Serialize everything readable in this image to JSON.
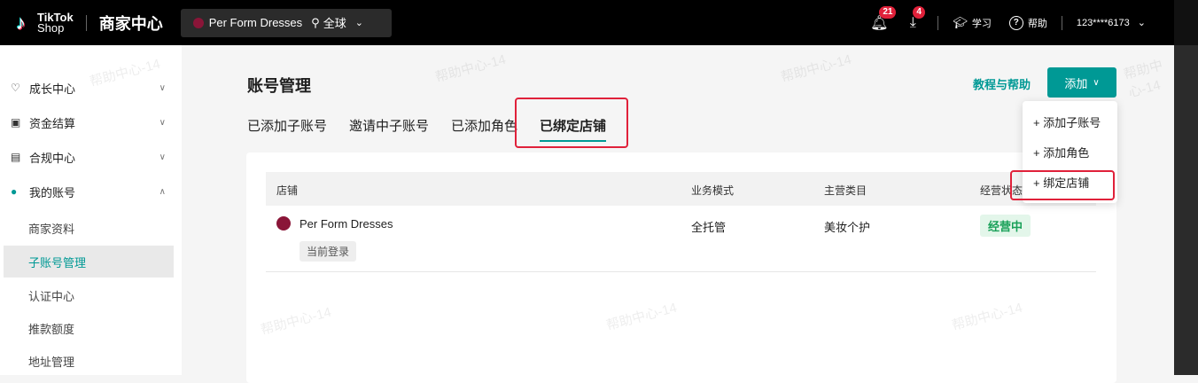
{
  "topbar": {
    "logo_line1": "TikTok",
    "logo_line2": "Shop",
    "center_title": "商家中心",
    "shop_name": "Per Form Dresses",
    "region": "全球",
    "notif_count": "21",
    "download_count": "4",
    "learn_label": "学习",
    "help_label": "帮助",
    "account": "123****6173"
  },
  "sidebar": {
    "items": [
      {
        "label": "成长中心"
      },
      {
        "label": "资金结算"
      },
      {
        "label": "合规中心"
      },
      {
        "label": "我的账号"
      }
    ],
    "sub_items": [
      {
        "label": "商家资料"
      },
      {
        "label": "子账号管理"
      },
      {
        "label": "认证中心"
      },
      {
        "label": "推款额度"
      },
      {
        "label": "地址管理"
      }
    ]
  },
  "main": {
    "title": "账号管理",
    "help_link": "教程与帮助",
    "add_button": "添加",
    "tabs": [
      {
        "label": "已添加子账号"
      },
      {
        "label": "邀请中子账号"
      },
      {
        "label": "已添加角色"
      },
      {
        "label": "已绑定店铺"
      }
    ],
    "table": {
      "headers": [
        "店铺",
        "业务模式",
        "主营类目",
        "经营状态"
      ],
      "rows": [
        {
          "shop": "Per Form Dresses",
          "tag": "当前登录",
          "mode": "全托管",
          "category": "美妆个护",
          "status": "经营中"
        }
      ]
    },
    "dropdown": [
      {
        "label": "+ 添加子账号"
      },
      {
        "label": "+ 添加角色"
      },
      {
        "label": "+ 绑定店铺"
      }
    ]
  },
  "watermark": "帮助中心-14",
  "colors": {
    "accent": "#009995",
    "highlight_red": "#e0213a",
    "status_green": "#18a058"
  }
}
